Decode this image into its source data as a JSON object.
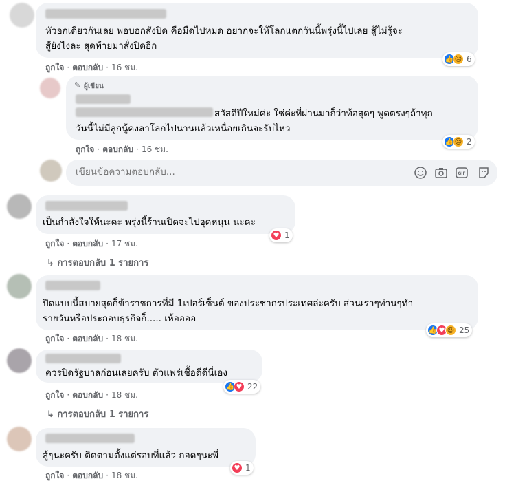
{
  "comments": [
    {
      "text_lines": [
        "หัวอกเดียวกันเลย พอบอกสั่งปิด คือมืดไปหมด อยากจะให้โลกแตกวันนี้พรุ่งนี้ไปเลย สู้ไม่รู้จะ",
        "สู้ยังไงละ สุดท้ายมาสั่งปิดอีก"
      ],
      "like": "ถูกใจ",
      "reply": "ตอบกลับ",
      "time": "16 ชม.",
      "reaction_count": "6"
    },
    {
      "author_tag": "ผู้เขียน",
      "text_lines": [
        "สวัสดีปีใหม่ค่ะ ใช่ค่ะที่ผ่านมาก็ว่าท้อสุดๆ พูดตรงๆถ้าทุก",
        "วันนี้ไม่มีลูกนู้คงลาโลกไปนานแล้วเหนื่อยเกินจะรับไหว"
      ],
      "like": "ถูกใจ",
      "reply": "ตอบกลับ",
      "time": "16 ชม.",
      "reaction_count": "2"
    },
    {
      "text_lines": [
        "เป็นกำลังใจให้นะคะ พรุ่งนี้ร้านเปิดจะไปอุดหนุน นะคะ"
      ],
      "like": "ถูกใจ",
      "reply": "ตอบกลับ",
      "time": "17 ชม.",
      "reaction_count": "1",
      "replies_label": "การตอบกลับ 1 รายการ"
    },
    {
      "text_lines": [
        "ปิดแบบนี้สบายสุดก็ข้าราชการที่มี 1เปอร์เซ็นต์ ของประชากรประเทศล่ะครับ ส่วนเราๆท่านๆทำ",
        "รายวันหรือประกอบธุรกิจก็..... เห้ออออ"
      ],
      "like": "ถูกใจ",
      "reply": "ตอบกลับ",
      "time": "18 ชม.",
      "reaction_count": "25"
    },
    {
      "text_lines": [
        "ควรปิดรัฐบาลก่อนเลยครับ ตัวแพร่เชื้อดีดีนี่เอง"
      ],
      "like": "ถูกใจ",
      "reply": "ตอบกลับ",
      "time": "18 ชม.",
      "reaction_count": "22",
      "replies_label": "การตอบกลับ 1 รายการ"
    },
    {
      "text_lines": [
        "สู้ๆนะครับ ติดตามตั้งแต่รอบที่แล้ว กอดๆนะพี่"
      ],
      "like": "ถูกใจ",
      "reply": "ตอบกลับ",
      "time": "18 ชม.",
      "reaction_count": "1"
    }
  ],
  "reply_box": {
    "placeholder": "เขียนข้อความตอบกลับ..."
  },
  "icons": {
    "like": "thumbs-up-icon",
    "love": "heart-icon",
    "sad": "sad-face-icon",
    "haha": "laugh-face-icon",
    "care": "care-face-icon"
  },
  "colors": {
    "bubble": "#f0f2f5",
    "like": "#1877f2",
    "love": "#f33e58",
    "meta": "#65676b"
  }
}
